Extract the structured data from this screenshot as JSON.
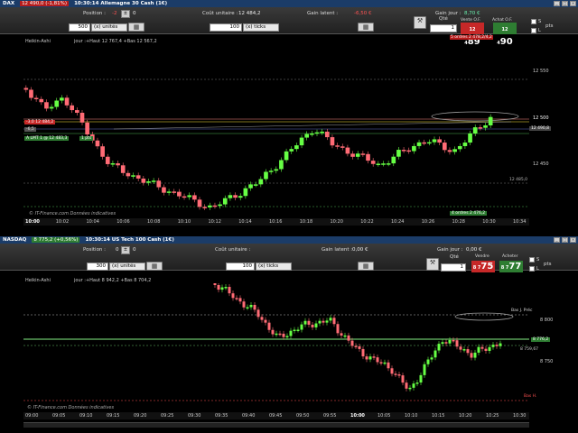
{
  "colors": {
    "title_bar": "#1b3c68",
    "up_candle": "#66ff44",
    "down_candle": "#ff6b75",
    "sell": "#c62828",
    "buy": "#2e7d32",
    "neg_text": "#ff5252",
    "pos_text": "#69f0ae"
  },
  "top": {
    "title": {
      "instrument": "DAX",
      "change": "12 490,0 (-1,81%)",
      "session": "10:30:14 Allemagne 30 Cash (1€)"
    },
    "orderbar": {
      "position_label": "Position :",
      "position_value": "-2",
      "position_avg": "0",
      "cout_label": "Coût unitaire :",
      "cout_value": "12 484,2",
      "gain_latent_label": "Gain latent :",
      "gain_latent_value": "-6,50 €",
      "gain_jour_label": "Gain jour :",
      "gain_jour_value": "8,70 €",
      "qty_units": "500",
      "units_label": "(x) unités",
      "qty_ticks": "100",
      "ticks_label": "(x) ticks",
      "qte_label": "Qté",
      "qte_value": "1",
      "vente_label": "Vente O.F.",
      "vente_prefix": "12 4",
      "vente_main": "89",
      "achat_label": "Achat O.F.",
      "achat_prefix": "12 4",
      "achat_main": "90",
      "pts_label": "pts",
      "order_note": "5 ordres 2 478,2/4,2",
      "checkbox_sl": "S",
      "checkbox_l": "L"
    },
    "chart_info": "jour :+Haut 12 767,4 +Bas 12 567,2",
    "indicator": "Heikin-Ashi",
    "position_tag": "-3.0 12 484,2",
    "position_sub": "-6,5",
    "alert_tag": "A LMT 1 @ 12 483,3",
    "alert_pts": "1 pts",
    "order_tag": "4 ordres 2 476,2",
    "brand": "© IT-Finance.com Données indicatives",
    "price_labels": [
      "12 550",
      "12 500",
      "12 450"
    ],
    "last_price_tag": "12 490,8",
    "side_price": "12 485,0",
    "time_labels": [
      "10:00",
      "10:02",
      "10:04",
      "10:06",
      "10:08",
      "10:10",
      "10:12",
      "10:14",
      "10:16",
      "10:18",
      "10:20",
      "10:22",
      "10:24",
      "10:26",
      "10:28",
      "10:30",
      "10:34"
    ]
  },
  "bottom": {
    "title": {
      "instrument": "NASDAQ",
      "change": "8 775,2 (+0,56%)",
      "session": "10:30:14 US Tech 100 Cash (1€)"
    },
    "orderbar": {
      "position_label": "Position :",
      "position_value": "0",
      "position_avg": "0",
      "cout_label": "Coût unitaire :",
      "gain_latent_label": "Gain latent :",
      "gain_latent_value": "0,00 €",
      "gain_jour_label": "Gain jour :",
      "gain_jour_value": "0,00 €",
      "qty_units": "300",
      "units_label": "(x) unités",
      "qty_ticks": "100",
      "ticks_label": "(x) ticks",
      "qte_label": "Qté",
      "qte_value": "1",
      "vente_label": "Vendre",
      "vente_prefix": "8 7",
      "vente_main": "75",
      "achat_label": "Acheter",
      "achat_prefix": "8 7",
      "achat_main": "77",
      "pts_label": "pts",
      "checkbox_sl": "S",
      "checkbox_l": "L"
    },
    "chart_info": "jour :+Haut 8 942,2 +Bas 8 704,2",
    "indicator": "Heikin-Ashi",
    "brand": "© IT-Finance.com Données indicatives",
    "price_labels": [
      "8 800",
      "8 750"
    ],
    "top_tag": "Bas J. Préc",
    "bottom_tag": "Bas H.",
    "last_price_tag": "8 776,2",
    "side_price": "8 759,67",
    "time_labels": [
      "09:00",
      "09:05",
      "09:10",
      "09:15",
      "09:20",
      "09:25",
      "09:30",
      "09:35",
      "09:40",
      "09:45",
      "09:50",
      "09:55",
      "10:00",
      "10:05",
      "10:10",
      "10:15",
      "10:20",
      "10:25",
      "10:30"
    ]
  }
}
